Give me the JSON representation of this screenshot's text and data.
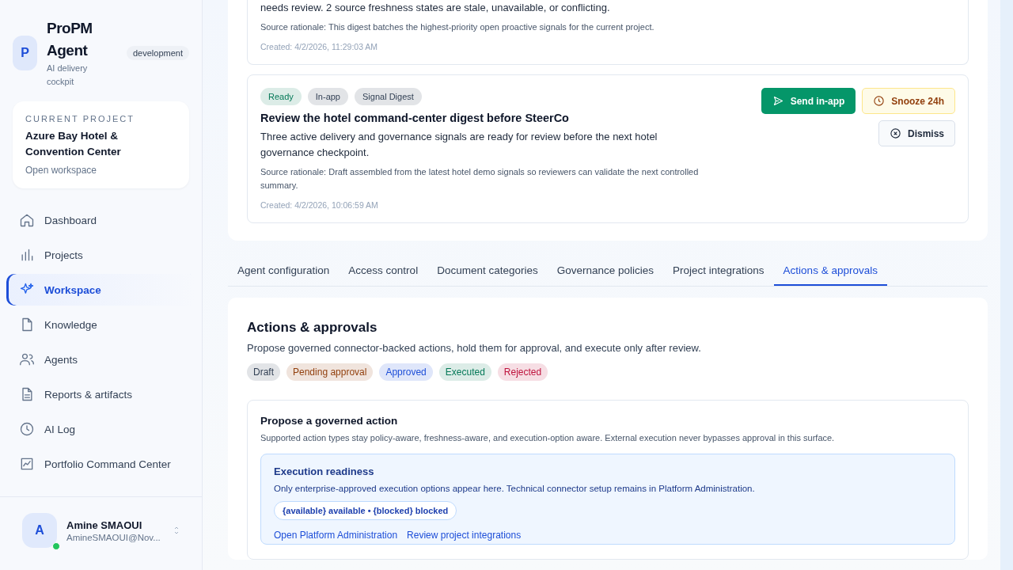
{
  "brand": {
    "logo": "P",
    "name": "ProPM Agent",
    "tagline": "AI delivery cockpit",
    "env": "development"
  },
  "current_project": {
    "label": "CURRENT PROJECT",
    "name": "Azure Bay Hotel & Convention Center",
    "link": "Open workspace"
  },
  "nav": [
    {
      "label": "Dashboard",
      "selected": false
    },
    {
      "label": "Projects",
      "selected": false
    },
    {
      "label": "Workspace",
      "selected": true
    },
    {
      "label": "Knowledge",
      "selected": false
    },
    {
      "label": "Agents",
      "selected": false
    },
    {
      "label": "Reports & artifacts",
      "selected": false
    },
    {
      "label": "AI Log",
      "selected": false
    },
    {
      "label": "Portfolio Command Center",
      "selected": false
    }
  ],
  "user": {
    "initial": "A",
    "name": "Amine SMAOUI",
    "email": "AmineSMAOUI@Nov...",
    "online": true
  },
  "signals": [
    {
      "description": "needs review. 2 source freshness states are stale, unavailable, or conflicting.",
      "rationale": "Source rationale: This digest batches the highest-priority open proactive signals for the current project.",
      "created": "Created: 4/2/2026, 11:29:03 AM"
    },
    {
      "badges": [
        {
          "label": "Ready",
          "color": "#047857"
        },
        {
          "label": "In-app",
          "color": "#334155"
        },
        {
          "label": "Signal Digest",
          "color": "#334155"
        }
      ],
      "title": "Review the hotel command-center digest before SteerCo",
      "description": "Three active delivery and governance signals are ready for review before the next hotel governance checkpoint.",
      "rationale": "Source rationale: Draft assembled from the latest hotel demo signals so reviewers can validate the next controlled summary.",
      "created": "Created: 4/2/2026, 10:06:59 AM",
      "actions": [
        {
          "label": "Send in-app",
          "kind": "primary"
        },
        {
          "label": "Snooze 24h",
          "kind": "warning"
        },
        {
          "label": "Dismiss",
          "kind": "secondary"
        }
      ]
    }
  ],
  "tabs": [
    {
      "label": "Agent configuration",
      "selected": false
    },
    {
      "label": "Access control",
      "selected": false
    },
    {
      "label": "Document categories",
      "selected": false
    },
    {
      "label": "Governance policies",
      "selected": false
    },
    {
      "label": "Project integrations",
      "selected": false
    },
    {
      "label": "Actions & approvals",
      "selected": true
    }
  ],
  "actions_panel": {
    "title": "Actions & approvals",
    "description": "Propose governed connector-backed actions, hold them for approval, and execute only after review.",
    "statuses": [
      {
        "label": "Draft",
        "color": "#334155"
      },
      {
        "label": "Pending approval",
        "color": "#92400e"
      },
      {
        "label": "Approved",
        "color": "#1d4ed8"
      },
      {
        "label": "Executed",
        "color": "#047857"
      },
      {
        "label": "Rejected",
        "color": "#be123c"
      }
    ],
    "propose": {
      "title": "Propose a governed action",
      "description": "Supported action types stay policy-aware, freshness-aware, and execution-option aware. External execution never bypasses approval in this surface.",
      "readiness": {
        "title": "Execution readiness",
        "description": "Only enterprise-approved execution options appear here. Technical connector setup remains in Platform Administration.",
        "pill": "{available} available • {blocked} blocked",
        "links": [
          "Open Platform Administration",
          "Review project integrations"
        ]
      }
    }
  }
}
